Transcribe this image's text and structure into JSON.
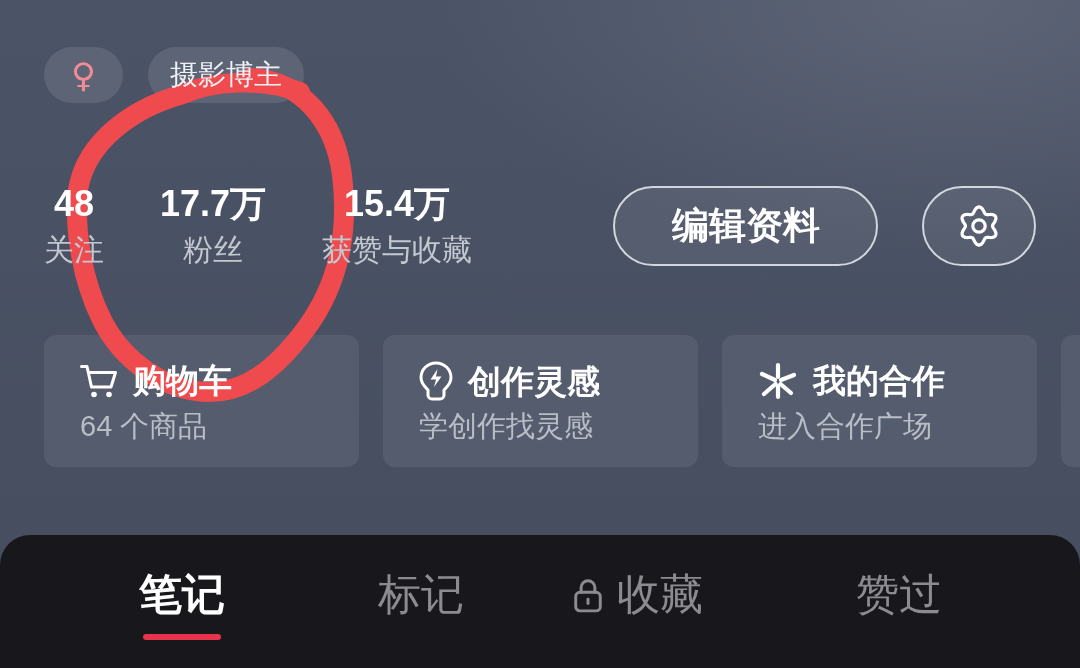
{
  "tags": [
    {
      "kind": "symbol",
      "text": "♀"
    },
    {
      "kind": "label",
      "text": "摄影博主"
    }
  ],
  "stats": [
    {
      "value": "48",
      "label": "关注"
    },
    {
      "value": "17.7万",
      "label": "粉丝"
    },
    {
      "value": "15.4万",
      "label": "获赞与收藏"
    }
  ],
  "edit_button": {
    "label": "编辑资料"
  },
  "shortcuts": [
    {
      "title": "购物车",
      "subtitle": "64 个商品"
    },
    {
      "title": "创作灵感",
      "subtitle": "学创作找灵感"
    },
    {
      "title": "我的合作",
      "subtitle": "进入合作广场"
    }
  ],
  "tabs": [
    {
      "label": "笔记",
      "selected": true,
      "locked": false
    },
    {
      "label": "标记",
      "selected": false,
      "locked": false
    },
    {
      "label": "收藏",
      "selected": false,
      "locked": true
    },
    {
      "label": "赞过",
      "selected": false,
      "locked": false
    }
  ]
}
